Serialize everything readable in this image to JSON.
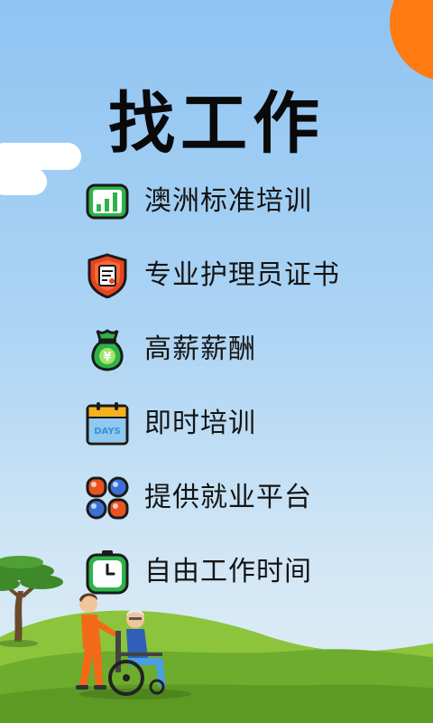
{
  "page": {
    "title": "找工作"
  },
  "features": [
    {
      "label": "澳洲标准培训",
      "icon": "chart-icon",
      "color": "#2eb24a"
    },
    {
      "label": "专业护理员证书",
      "icon": "certificate-shield-icon",
      "color": "#e8441f"
    },
    {
      "label": "高薪薪酬",
      "icon": "money-bag-icon",
      "color": "#2eb24a"
    },
    {
      "label": "即时培训",
      "icon": "calendar-days-icon",
      "color": "#3b8fd6",
      "icon_text": "DAYS"
    },
    {
      "label": "提供就业平台",
      "icon": "grid-dots-icon",
      "color": "#e8531f"
    },
    {
      "label": "自由工作时间",
      "icon": "clock-icon",
      "color": "#2eb24a"
    }
  ],
  "colors": {
    "sun": "#ff7a10",
    "sky_top": "#8fc4f2",
    "hill": "#7ab83a"
  }
}
